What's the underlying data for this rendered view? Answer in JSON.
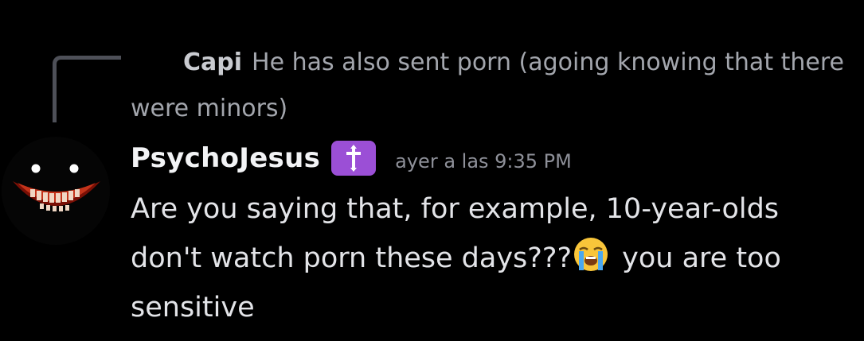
{
  "reply": {
    "author": "Capi",
    "text": "He has also sent porn (agoing knowing that there were minors)"
  },
  "message": {
    "author": "PsychoJesus",
    "role_icon": "cross-badge-icon",
    "role_color": "#9b4fd6",
    "timestamp": "ayer a las 9:35 PM",
    "content_part1": "Are you saying that, for example, 10-year-olds don't watch porn these days???",
    "emoji": "loudly-crying-face",
    "content_part2": " you are too sensitive"
  },
  "colors": {
    "background": "#000000",
    "username": "#f2f3f5",
    "timestamp": "#8e9099",
    "reply_text": "#a3a6ad"
  }
}
